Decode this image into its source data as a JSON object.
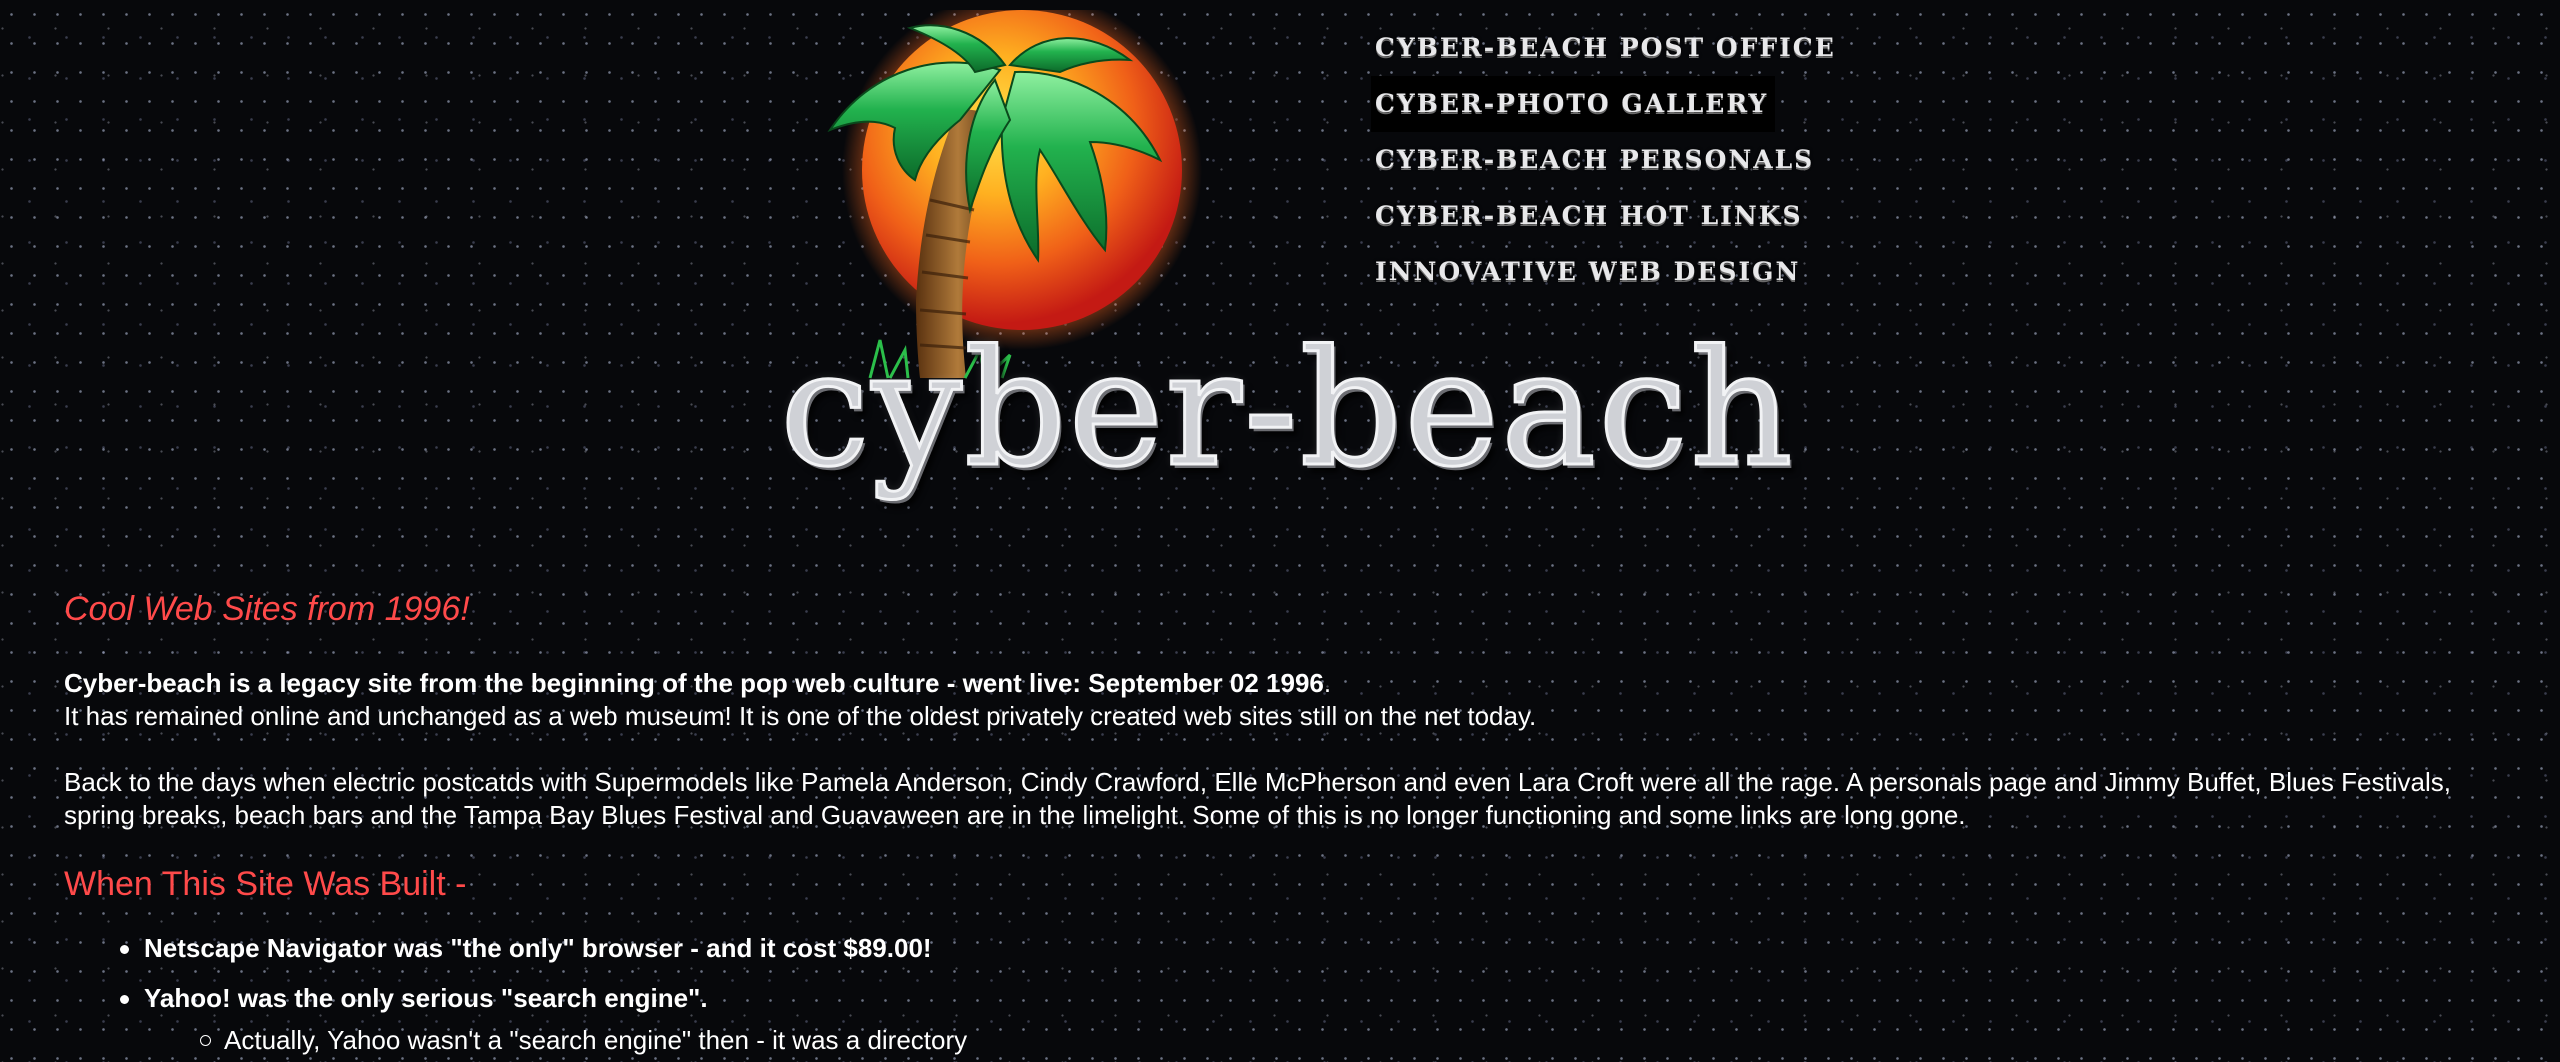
{
  "header": {
    "logo_wordmark": "cyber-beach",
    "logo_icon": "palm-tree-sunset-logo",
    "nav": [
      {
        "label": "CYBER-BEACH POST OFFICE",
        "active": false
      },
      {
        "label": "CYBER-PHOTO GALLERY",
        "active": true
      },
      {
        "label": "CYBER-BEACH PERSONALS",
        "active": false
      },
      {
        "label": "CYBER-BEACH HOT LINKS",
        "active": false
      },
      {
        "label": "INNOVATIVE WEB DESIGN",
        "active": false
      }
    ]
  },
  "main": {
    "intro_title": "Cool Web Sites from 1996!",
    "intro_bold": "Cyber-beach is a legacy site from the beginning of the pop web culture - went live: September 02 1996",
    "intro_bold_end": ".",
    "intro_line2": "It has remained online and unchanged as a web museum! It is one of the oldest privately created web sites still on the net today.",
    "history_text": "Back to the days when electric postcatds with Supermodels like Pamela Anderson, Cindy Crawford, Elle McPherson and even Lara Croft were all the rage. A personals page and Jimmy Buffet, Blues Festivals, spring breaks, beach bars and the Tampa Bay Blues Festival and Guavaween are in the limelight. Some of this is no longer functioning and some links are long gone.",
    "built_title": "When This Site Was Built -",
    "facts": [
      "Netscape Navigator was \"the only\" browser - and it cost $89.00!",
      "Yahoo! was the only serious \"search engine\"."
    ],
    "sub_facts": [
      "Actually, Yahoo wasn't a \"search engine\" then - it was a directory"
    ]
  },
  "colors": {
    "background": "#07080b",
    "heading": "#ff4a4a",
    "text": "#ffffff",
    "nav_text": "#e8e8ea",
    "palm_leaf": "#1fa84a",
    "sun_outer": "#d92a1c",
    "sun_inner": "#ffcc22"
  }
}
